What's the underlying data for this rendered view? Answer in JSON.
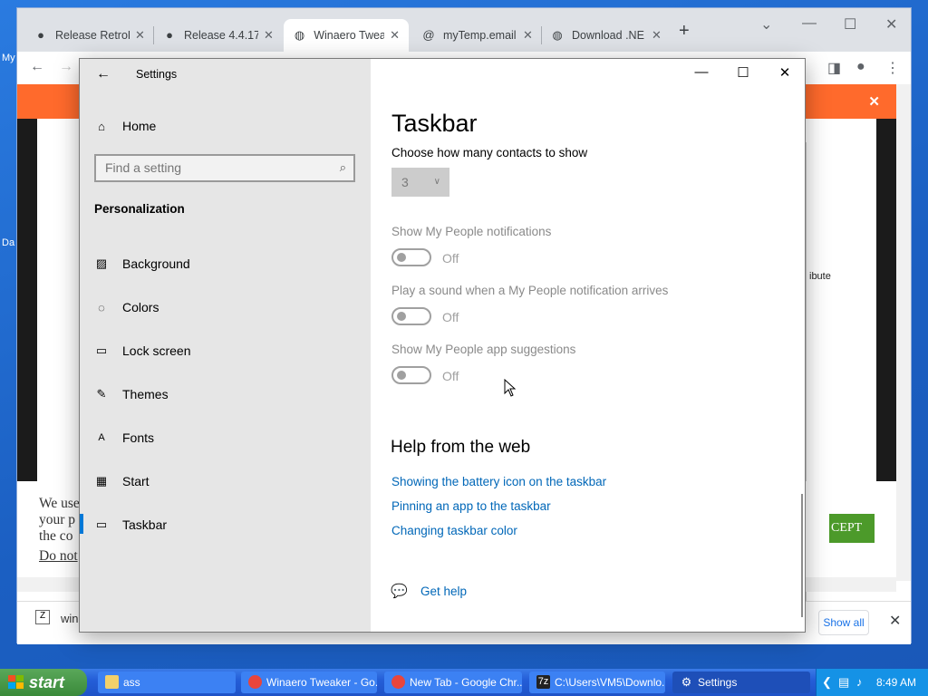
{
  "desktop": {
    "frag_my": "My",
    "frag_da": "Da"
  },
  "browser": {
    "tabs": [
      {
        "title": "Release RetroB",
        "icon": "github-icon"
      },
      {
        "title": "Release 4.4.17",
        "icon": "github-icon"
      },
      {
        "title": "Winaero Tweak",
        "icon": "globe-icon"
      },
      {
        "title": "myTemp.email",
        "icon": "at-icon"
      },
      {
        "title": "Download .NE",
        "icon": "globe-icon"
      }
    ],
    "page_fragments": {
      "cookie_line1": "We use",
      "cookie_line2": "your p",
      "cookie_line3": "the co",
      "cookie_link": "Do not",
      "accept": "CEPT",
      "attribute": "ibute"
    },
    "downloads": {
      "file": "win",
      "show_all": "Show all"
    }
  },
  "settings": {
    "window_title": "Settings",
    "home": "Home",
    "search_placeholder": "Find a setting",
    "section": "Personalization",
    "nav": [
      {
        "label": "Background",
        "icon": "picture-icon"
      },
      {
        "label": "Colors",
        "icon": "palette-icon"
      },
      {
        "label": "Lock screen",
        "icon": "lock-screen-icon"
      },
      {
        "label": "Themes",
        "icon": "themes-icon"
      },
      {
        "label": "Fonts",
        "icon": "fonts-icon"
      },
      {
        "label": "Start",
        "icon": "start-icon"
      },
      {
        "label": "Taskbar",
        "icon": "taskbar-icon",
        "selected": true
      }
    ],
    "page": {
      "title": "Taskbar",
      "contacts_label": "Choose how many contacts to show",
      "contacts_value": "3",
      "toggles": [
        {
          "label": "Show My People notifications",
          "state": "Off"
        },
        {
          "label": "Play a sound when a My People notification arrives",
          "state": "Off"
        },
        {
          "label": "Show My People app suggestions",
          "state": "Off"
        }
      ],
      "help_heading": "Help from the web",
      "help_links": [
        "Showing the battery icon on the taskbar",
        "Pinning an app to the taskbar",
        "Changing taskbar color"
      ],
      "get_help": "Get help"
    }
  },
  "taskbar": {
    "start": "start",
    "items": [
      {
        "label": "ass",
        "icon": "folder-icon"
      },
      {
        "label": "Winaero Tweaker - Go...",
        "icon": "chrome-icon"
      },
      {
        "label": "New Tab - Google Chr...",
        "icon": "chrome-icon"
      },
      {
        "label": "C:\\Users\\VM5\\Downlo...",
        "icon": "7zip-icon"
      },
      {
        "label": "Settings",
        "icon": "gear-icon",
        "active": true
      }
    ],
    "clock": "8:49 AM"
  },
  "colors": {
    "accent": "#0078d7",
    "link": "#0067b8",
    "orange": "#ff6a2c"
  }
}
